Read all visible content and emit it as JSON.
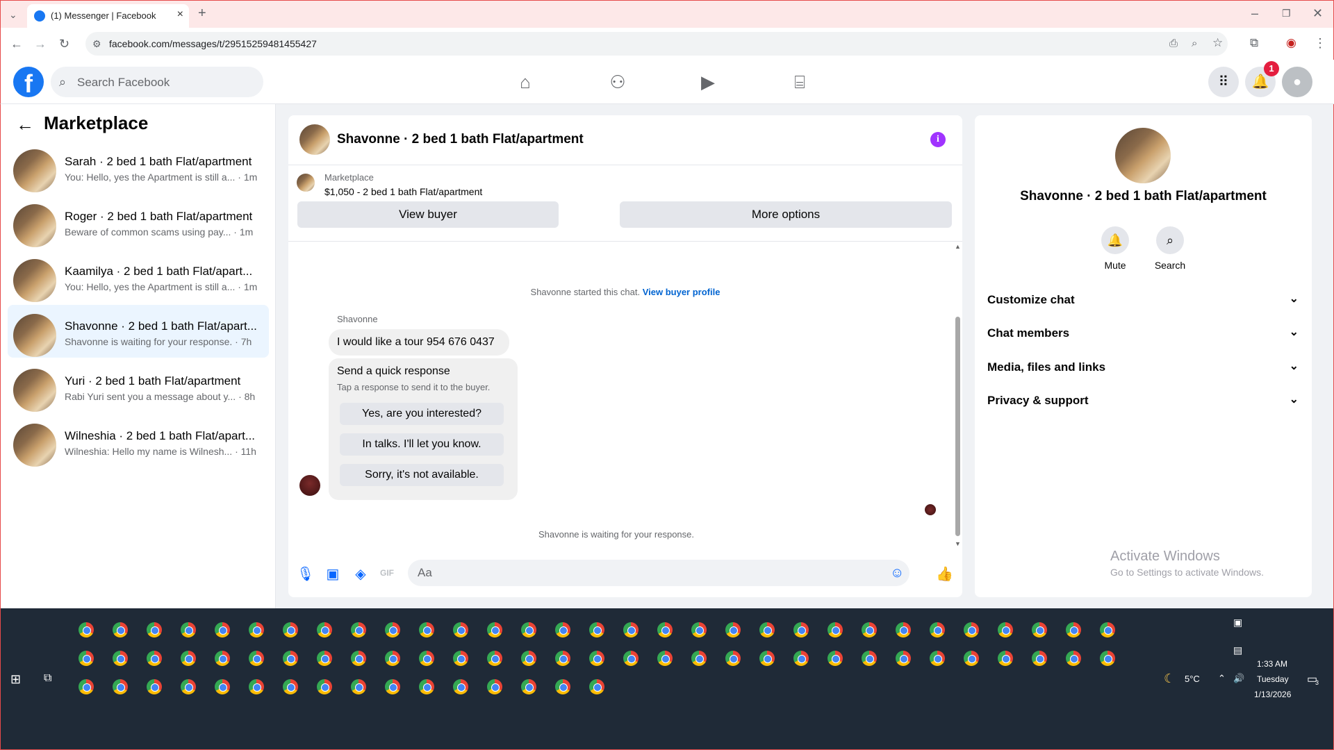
{
  "browser": {
    "tab_title": "(1) Messenger | Facebook",
    "url": "facebook.com/messages/t/29515259481455427"
  },
  "facebook": {
    "search_placeholder": "Search Facebook",
    "notification_count": "1"
  },
  "left_panel": {
    "title": "Marketplace",
    "conversations": [
      {
        "name": "Sarah · 2 bed 1 bath Flat/apartment",
        "preview": "You: Hello, yes the Apartment is still a...",
        "time": "· 1m"
      },
      {
        "name": "Roger · 2 bed 1 bath Flat/apartment",
        "preview": "Beware of common scams using pay...",
        "time": "· 1m"
      },
      {
        "name": "Kaamilya · 2 bed 1 bath Flat/apart...",
        "preview": "You: Hello, yes the Apartment is still a...",
        "time": "· 1m"
      },
      {
        "name": "Shavonne · 2 bed 1 bath Flat/apart...",
        "preview": "Shavonne is waiting for your response.",
        "time": "· 7h"
      },
      {
        "name": "Yuri · 2 bed 1 bath Flat/apartment",
        "preview": "Rabi Yuri sent you a message about y...",
        "time": "· 8h"
      },
      {
        "name": "Wilneshia · 2 bed 1 bath Flat/apart...",
        "preview": "Wilneshia: Hello my name is Wilnesh...",
        "time": "· 11h"
      }
    ]
  },
  "chat": {
    "header_name": "Shavonne · 2 bed 1 bath Flat/apartment",
    "listing_label": "Marketplace",
    "listing_price": "$1,050 - 2 bed 1 bath Flat/apartment",
    "view_buyer": "View buyer",
    "more_options": "More options",
    "started_text": "Shavonne started this chat.",
    "view_buyer_profile": "View buyer profile",
    "sender": "Shavonne",
    "message": "I would like a tour 954 676 0437",
    "quick_title": "Send a quick response",
    "quick_sub": "Tap a response to send it to the buyer.",
    "quick_options": [
      "Yes, are you interested?",
      "In talks. I'll let you know.",
      "Sorry, it's not available."
    ],
    "waiting_text": "Shavonne is waiting for your response.",
    "composer_placeholder": "Aa"
  },
  "right_panel": {
    "name": "Shavonne · 2 bed 1 bath Flat/apartment",
    "mute": "Mute",
    "search": "Search",
    "sections": [
      "Customize chat",
      "Chat members",
      "Media, files and links",
      "Privacy & support"
    ]
  },
  "watermark": {
    "title": "Activate Windows",
    "sub": "Go to Settings to activate Windows."
  },
  "taskbar": {
    "weather": "5°C",
    "time": "1:33 AM",
    "day": "Tuesday",
    "date": "1/13/2026",
    "notif_count": "3"
  }
}
